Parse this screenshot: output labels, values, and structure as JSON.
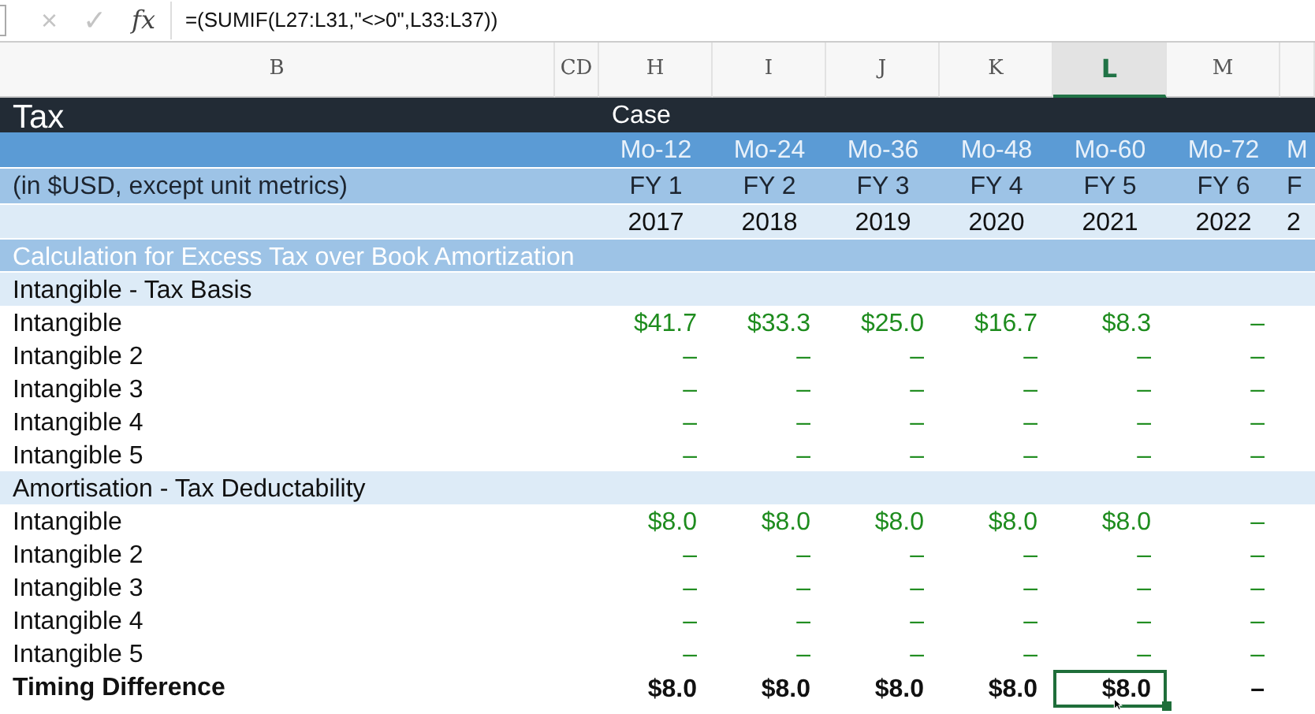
{
  "formula_bar": {
    "cancel": "×",
    "enter": "✓",
    "fx": "fx",
    "formula": "=(SUMIF(L27:L31,\"<>0\",L33:L37))"
  },
  "columns": [
    {
      "label": "B",
      "selected": false
    },
    {
      "label": "CD",
      "selected": false
    },
    {
      "label": "H",
      "selected": false
    },
    {
      "label": "I",
      "selected": false
    },
    {
      "label": "J",
      "selected": false
    },
    {
      "label": "K",
      "selected": false
    },
    {
      "label": "L",
      "selected": true
    },
    {
      "label": "M",
      "selected": false
    }
  ],
  "rows": [
    {
      "kind": "title",
      "label": "Tax",
      "values": [
        "Case"
      ]
    },
    {
      "kind": "period",
      "label": "",
      "values": [
        "Mo-12",
        "Mo-24",
        "Mo-36",
        "Mo-48",
        "Mo-60",
        "Mo-72",
        "M"
      ]
    },
    {
      "kind": "fy",
      "label": "(in $USD, except unit metrics)",
      "values": [
        "FY 1",
        "FY 2",
        "FY 3",
        "FY 4",
        "FY 5",
        "FY 6",
        "F"
      ]
    },
    {
      "kind": "year",
      "label": "",
      "values": [
        "2017",
        "2018",
        "2019",
        "2020",
        "2021",
        "2022",
        "2"
      ]
    },
    {
      "kind": "section",
      "label": "Calculation for Excess Tax over Book Amortization",
      "values": []
    },
    {
      "kind": "subsection",
      "label": "Intangible - Tax Basis",
      "values": []
    },
    {
      "kind": "line",
      "label": "Intangible",
      "values": [
        "$41.7",
        "$33.3",
        "$25.0",
        "$16.7",
        "$8.3",
        "–"
      ]
    },
    {
      "kind": "line",
      "label": "Intangible 2",
      "values": [
        "–",
        "–",
        "–",
        "–",
        "–",
        "–"
      ]
    },
    {
      "kind": "line",
      "label": "Intangible 3",
      "values": [
        "–",
        "–",
        "–",
        "–",
        "–",
        "–"
      ]
    },
    {
      "kind": "line",
      "label": "Intangible 4",
      "values": [
        "–",
        "–",
        "–",
        "–",
        "–",
        "–"
      ]
    },
    {
      "kind": "line",
      "label": "Intangible 5",
      "values": [
        "–",
        "–",
        "–",
        "–",
        "–",
        "–"
      ]
    },
    {
      "kind": "subsection",
      "label": "Amortisation - Tax Deductability",
      "values": []
    },
    {
      "kind": "line",
      "label": "Intangible",
      "values": [
        "$8.0",
        "$8.0",
        "$8.0",
        "$8.0",
        "$8.0",
        "–"
      ]
    },
    {
      "kind": "line",
      "label": "Intangible 2",
      "values": [
        "–",
        "–",
        "–",
        "–",
        "–",
        "–"
      ]
    },
    {
      "kind": "line",
      "label": "Intangible 3",
      "values": [
        "–",
        "–",
        "–",
        "–",
        "–",
        "–"
      ]
    },
    {
      "kind": "line",
      "label": "Intangible 4",
      "values": [
        "–",
        "–",
        "–",
        "–",
        "–",
        "–"
      ]
    },
    {
      "kind": "line",
      "label": "Intangible 5",
      "values": [
        "–",
        "–",
        "–",
        "–",
        "–",
        "–"
      ]
    },
    {
      "kind": "total",
      "label": "Timing Difference",
      "values": [
        "$8.0",
        "$8.0",
        "$8.0",
        "$8.0",
        "$8.0",
        "–"
      ],
      "selected_cells": [
        false,
        false,
        false,
        false,
        true,
        false
      ]
    }
  ]
}
